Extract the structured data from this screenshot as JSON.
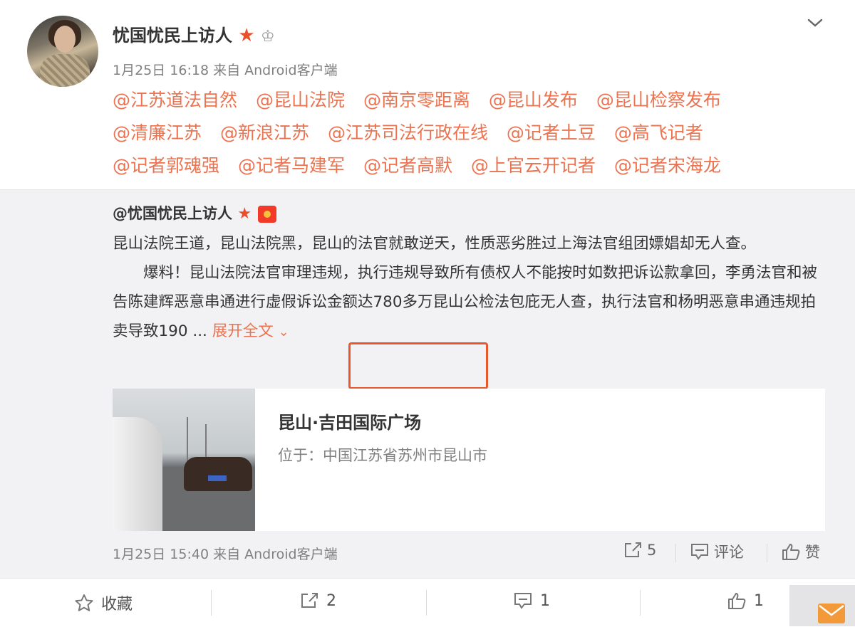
{
  "post": {
    "author": "忧国忧民上访人",
    "meta": "1月25日 16:18 来自 Android客户端",
    "mentions": [
      "@江苏道法自然",
      "@昆山法院",
      "@南京零距离",
      "@昆山发布",
      "@昆山检察发布",
      "@清廉江苏",
      "@新浪江苏",
      "@江苏司法行政在线",
      "@记者土豆",
      "@高飞记者",
      "@记者郭魂强",
      "@记者马建军",
      "@记者高默",
      "@上官云开记者",
      "@记者宋海龙"
    ]
  },
  "repost": {
    "author": "@忧国忧民上访人",
    "para1": "昆山法院王道，昆山法院黑，昆山的法官就敢逆天，性质恶劣胜过上海法官组团嫖娼却无人查。",
    "para2": "爆料！昆山法院法官审理违规，执行违规导致所有债权人不能按时如数把诉讼款拿回，李勇法官和被告陈建辉恶意串通进行虚假诉讼金额达780多万昆山公检法包庇无人查，执行法官和杨明恶意串通违规拍卖导致190 ...",
    "expand_label": "展开全文",
    "card": {
      "title": "昆山·吉田国际广场",
      "location": "位于：中国江苏省苏州市昆山市"
    },
    "meta": "1月25日 15:40 来自 Android客户端",
    "actions": {
      "repost_count": "5",
      "comment_label": "评论",
      "like_label": "赞"
    }
  },
  "bottom_bar": {
    "favorite_label": "收藏",
    "repost_count": "2",
    "comment_count": "1",
    "like_count": "1"
  },
  "colors": {
    "accent": "#eb7350",
    "highlight": "#e8582e",
    "repost_bg": "#f2f2f5"
  }
}
